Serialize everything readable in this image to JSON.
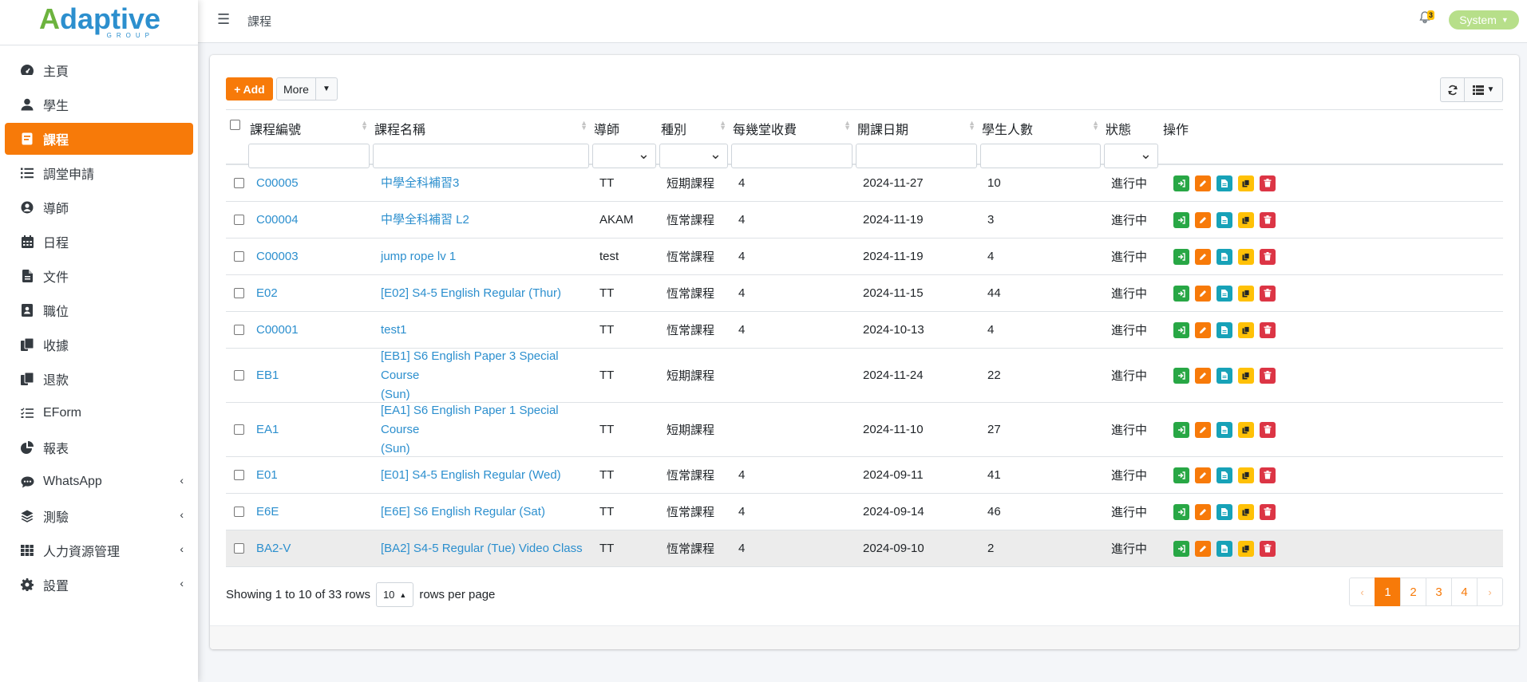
{
  "brand": {
    "logo_text": "Adaptive",
    "logo_sub": "GROUP"
  },
  "header": {
    "title": "課程",
    "notification_count": "3",
    "user": "System"
  },
  "sidebar": {
    "items": [
      {
        "label": "主頁",
        "icon": "dashboard-icon"
      },
      {
        "label": "學生",
        "icon": "user-icon"
      },
      {
        "label": "課程",
        "icon": "course-icon",
        "active": true
      },
      {
        "label": "調堂申請",
        "icon": "list-icon"
      },
      {
        "label": "導師",
        "icon": "user-circle-icon"
      },
      {
        "label": "日程",
        "icon": "calendar-icon"
      },
      {
        "label": "文件",
        "icon": "file-icon"
      },
      {
        "label": "職位",
        "icon": "id-card-icon"
      },
      {
        "label": "收據",
        "icon": "receipt-icon"
      },
      {
        "label": "退款",
        "icon": "refund-icon"
      },
      {
        "label": "EForm",
        "icon": "checklist-icon"
      },
      {
        "label": "報表",
        "icon": "pie-chart-icon"
      },
      {
        "label": "WhatsApp",
        "icon": "chat-icon",
        "expandable": true
      },
      {
        "label": "測驗",
        "icon": "layers-icon",
        "expandable": true
      },
      {
        "label": "人力資源管理",
        "icon": "grid-icon",
        "expandable": true
      },
      {
        "label": "設置",
        "icon": "gear-icon",
        "expandable": true
      }
    ]
  },
  "toolbar": {
    "add_label": "Add",
    "more_label": "More"
  },
  "table": {
    "columns": [
      "課程編號",
      "課程名稱",
      "導師",
      "種別",
      "每幾堂收費",
      "開課日期",
      "學生人數",
      "狀態",
      "操作"
    ],
    "rows": [
      {
        "code": "C00005",
        "name": "中學全科補習3",
        "name2": "",
        "tutor": "TT",
        "type": "短期課程",
        "fee": "4",
        "date": "2024-11-27",
        "students": "10",
        "status": "進行中"
      },
      {
        "code": "C00004",
        "name": "中學全科補習 L2",
        "name2": "",
        "tutor": "AKAM",
        "type": "恆常課程",
        "fee": "4",
        "date": "2024-11-19",
        "students": "3",
        "status": "進行中"
      },
      {
        "code": "C00003",
        "name": "jump rope lv 1",
        "name2": "",
        "tutor": "test",
        "type": "恆常課程",
        "fee": "4",
        "date": "2024-11-19",
        "students": "4",
        "status": "進行中"
      },
      {
        "code": "E02",
        "name": "[E02] S4-5 English Regular (Thur)",
        "name2": "",
        "tutor": "TT",
        "type": "恆常課程",
        "fee": "4",
        "date": "2024-11-15",
        "students": "44",
        "status": "進行中"
      },
      {
        "code": "C00001",
        "name": "test1",
        "name2": "",
        "tutor": "TT",
        "type": "恆常課程",
        "fee": "4",
        "date": "2024-10-13",
        "students": "4",
        "status": "進行中"
      },
      {
        "code": "EB1",
        "name": "[EB1] S6 English Paper 3 Special Course",
        "name2": "(Sun)",
        "tutor": "TT",
        "type": "短期課程",
        "fee": "",
        "date": "2024-11-24",
        "students": "22",
        "status": "進行中"
      },
      {
        "code": "EA1",
        "name": "[EA1] S6 English Paper 1 Special Course",
        "name2": "(Sun)",
        "tutor": "TT",
        "type": "短期課程",
        "fee": "",
        "date": "2024-11-10",
        "students": "27",
        "status": "進行中"
      },
      {
        "code": "E01",
        "name": "[E01] S4-5 English Regular (Wed)",
        "name2": "",
        "tutor": "TT",
        "type": "恆常課程",
        "fee": "4",
        "date": "2024-09-11",
        "students": "41",
        "status": "進行中"
      },
      {
        "code": "E6E",
        "name": "[E6E] S6 English Regular (Sat)",
        "name2": "",
        "tutor": "TT",
        "type": "恆常課程",
        "fee": "4",
        "date": "2024-09-14",
        "students": "46",
        "status": "進行中"
      },
      {
        "code": "BA2-V",
        "name": "[BA2] S4-5 Regular (Tue) Video Class",
        "name2": "",
        "tutor": "TT",
        "type": "恆常課程",
        "fee": "4",
        "date": "2024-09-10",
        "students": "2",
        "status": "進行中"
      }
    ]
  },
  "footer": {
    "showing": "Showing 1 to 10 of 33 rows",
    "page_size": "10",
    "rows_per_page": "rows per page",
    "pages": [
      "‹",
      "1",
      "2",
      "3",
      "4",
      "›"
    ],
    "current_page": "1"
  },
  "colors": {
    "accent": "#f77a09",
    "link": "#2c8fce",
    "green": "#28a745",
    "teal": "#17a2b8",
    "yellow": "#ffc107",
    "red": "#dc3545"
  }
}
